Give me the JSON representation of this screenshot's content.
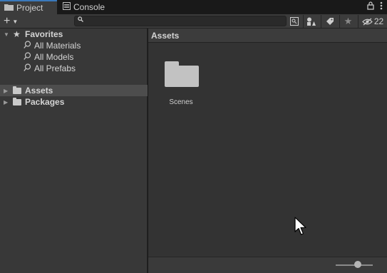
{
  "tabs": [
    {
      "label": "Project",
      "active": true
    },
    {
      "label": "Console",
      "active": false
    }
  ],
  "tab_icons": {
    "lock": "lock-icon",
    "menu": "kebab-menu-icon"
  },
  "toolbar": {
    "add_label": "+",
    "search_placeholder": "",
    "hidden_count": "22"
  },
  "left_panel": {
    "favorites": {
      "label": "Favorites",
      "items": [
        "All Materials",
        "All Models",
        "All Prefabs"
      ]
    },
    "roots": [
      {
        "label": "Assets",
        "selected": true
      },
      {
        "label": "Packages",
        "selected": false
      }
    ]
  },
  "right_panel": {
    "header": "Assets",
    "items": [
      {
        "name": "Scenes",
        "icon": "folder-icon"
      }
    ],
    "zoom_level": 0.5
  },
  "colors": {
    "accent": "#3a79bb",
    "panel": "#383838",
    "selection": "#4d4d4d"
  }
}
